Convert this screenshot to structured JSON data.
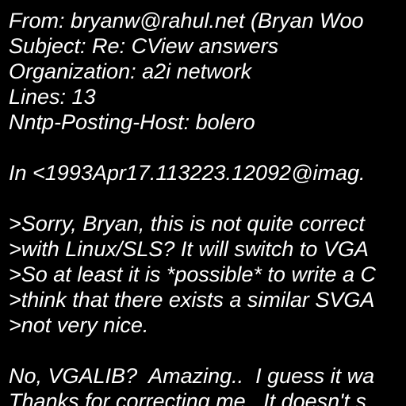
{
  "colors": {
    "background": "#000000",
    "text": "#ffffff"
  },
  "message": {
    "headers": {
      "from": "From: bryanw@rahul.net (Bryan Woo",
      "subject": "Subject: Re: CView answers",
      "organization": "Organization: a2i network",
      "lines": "Lines: 13",
      "posting_host": "Nntp-Posting-Host: bolero"
    },
    "attribution": "In <1993Apr17.113223.12092@imag.",
    "quoted": [
      ">Sorry, Bryan, this is not quite correct",
      ">with Linux/SLS? It will switch to VGA",
      ">So at least it is *possible* to write a C",
      ">think that there exists a similar SVGA",
      ">not very nice."
    ],
    "body": [
      "No, VGALIB?  Amazing..  I guess it wa",
      "Thanks for correcting me.  It doesn't s"
    ]
  }
}
